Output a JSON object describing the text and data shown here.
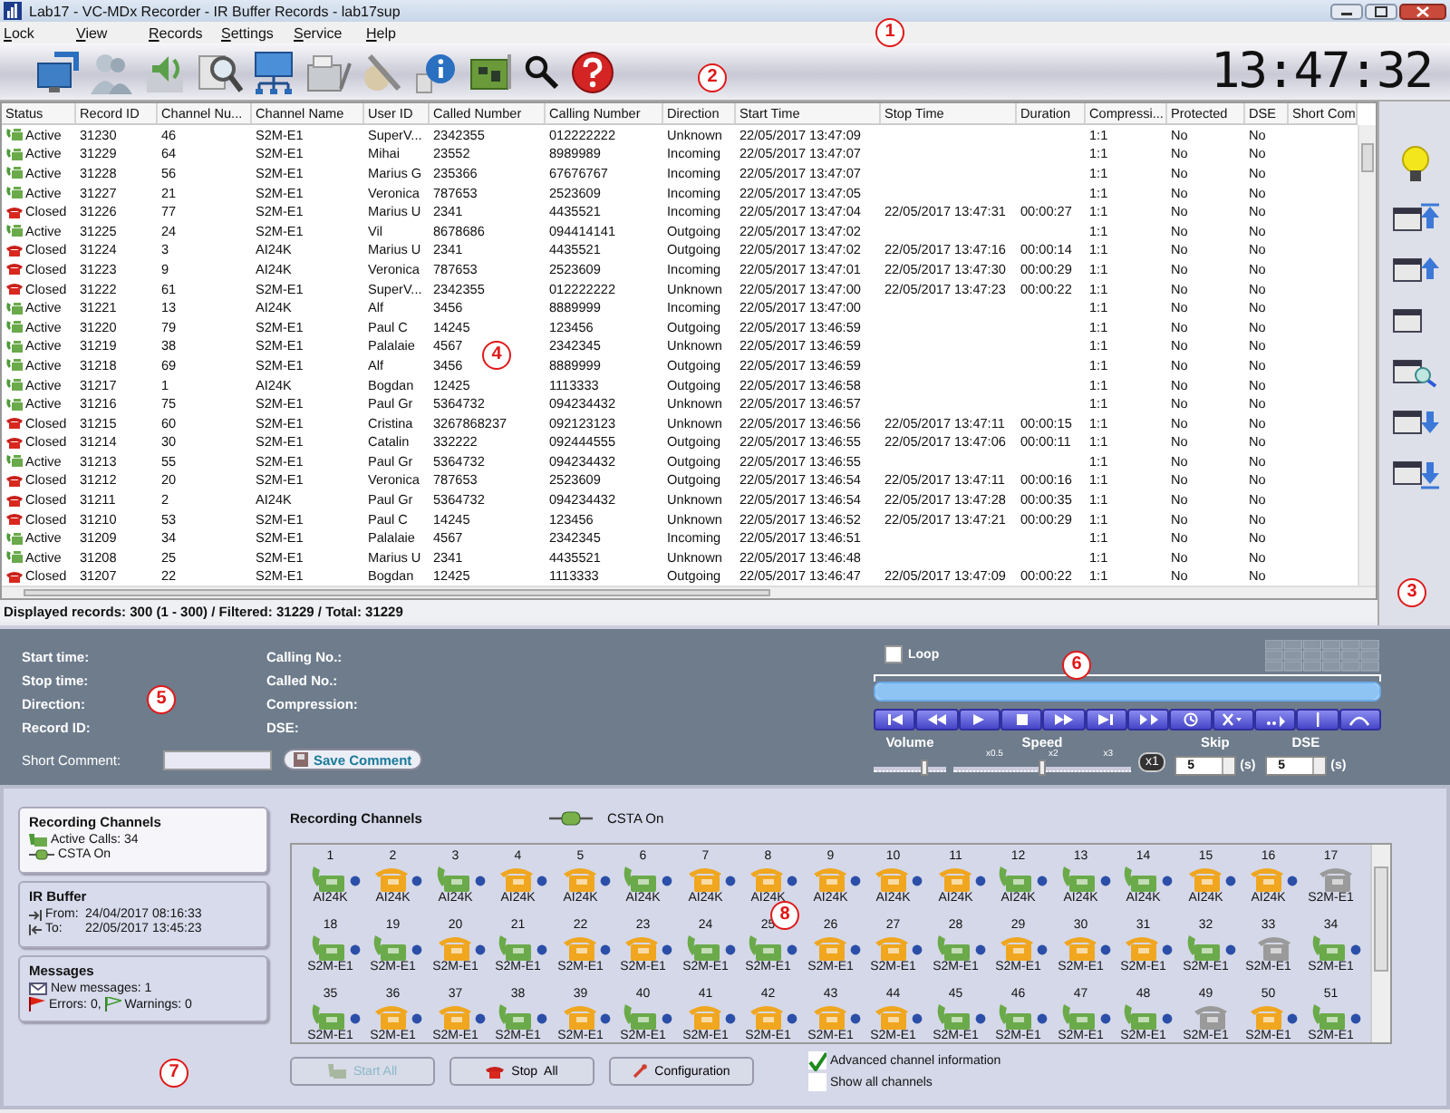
{
  "window": {
    "title": "Lab17 - VC-MDx Recorder - IR Buffer Records - lab17sup"
  },
  "menu": [
    "Lock",
    "View",
    "Records",
    "Settings",
    "Service",
    "Help"
  ],
  "clock": "13:47:32",
  "table": {
    "columns": [
      "Status",
      "Record ID",
      "Channel Nu...",
      "Channel Name",
      "User ID",
      "Called Number",
      "Calling Number",
      "Direction",
      "Start Time",
      "Stop Time",
      "Duration",
      "Compressi...",
      "Protected",
      "DSE",
      "Short Com"
    ],
    "rows": [
      {
        "kind": "active",
        "status": "Active",
        "record_id": "31230",
        "channel_number": "46",
        "channel_name": "S2M-E1",
        "user_id": "SuperV...",
        "called_number": "2342355",
        "calling_number": "012222222",
        "direction": "Unknown",
        "start_time": "22/05/2017 13:47:09",
        "compression": "1:1",
        "protected": "No",
        "dse": "No"
      },
      {
        "kind": "active",
        "status": "Active",
        "record_id": "31229",
        "channel_number": "64",
        "channel_name": "S2M-E1",
        "user_id": "Mihai",
        "called_number": "23552",
        "calling_number": "8989989",
        "direction": "Incoming",
        "start_time": "22/05/2017 13:47:07",
        "compression": "1:1",
        "protected": "No",
        "dse": "No"
      },
      {
        "kind": "active",
        "status": "Active",
        "record_id": "31228",
        "channel_number": "56",
        "channel_name": "S2M-E1",
        "user_id": "Marius G",
        "called_number": "235366",
        "calling_number": "67676767",
        "direction": "Incoming",
        "start_time": "22/05/2017 13:47:07",
        "compression": "1:1",
        "protected": "No",
        "dse": "No"
      },
      {
        "kind": "active",
        "status": "Active",
        "record_id": "31227",
        "channel_number": "21",
        "channel_name": "S2M-E1",
        "user_id": "Veronica",
        "called_number": "787653",
        "calling_number": "2523609",
        "direction": "Incoming",
        "start_time": "22/05/2017 13:47:05",
        "compression": "1:1",
        "protected": "No",
        "dse": "No"
      },
      {
        "kind": "closed",
        "status": "Closed",
        "record_id": "31226",
        "channel_number": "77",
        "channel_name": "S2M-E1",
        "user_id": "Marius U",
        "called_number": "2341",
        "calling_number": "4435521",
        "direction": "Incoming",
        "start_time": "22/05/2017 13:47:04",
        "stop_time": "22/05/2017 13:47:31",
        "duration": "00:00:27",
        "compression": "1:1",
        "protected": "No",
        "dse": "No"
      },
      {
        "kind": "active",
        "status": "Active",
        "record_id": "31225",
        "channel_number": "24",
        "channel_name": "S2M-E1",
        "user_id": "Vil",
        "called_number": "8678686",
        "calling_number": "094414141",
        "direction": "Outgoing",
        "start_time": "22/05/2017 13:47:02",
        "compression": "1:1",
        "protected": "No",
        "dse": "No"
      },
      {
        "kind": "closed",
        "status": "Closed",
        "record_id": "31224",
        "channel_number": "3",
        "channel_name": "AI24K",
        "user_id": "Marius U",
        "called_number": "2341",
        "calling_number": "4435521",
        "direction": "Outgoing",
        "start_time": "22/05/2017 13:47:02",
        "stop_time": "22/05/2017 13:47:16",
        "duration": "00:00:14",
        "compression": "1:1",
        "protected": "No",
        "dse": "No"
      },
      {
        "kind": "closed",
        "status": "Closed",
        "record_id": "31223",
        "channel_number": "9",
        "channel_name": "AI24K",
        "user_id": "Veronica",
        "called_number": "787653",
        "calling_number": "2523609",
        "direction": "Incoming",
        "start_time": "22/05/2017 13:47:01",
        "stop_time": "22/05/2017 13:47:30",
        "duration": "00:00:29",
        "compression": "1:1",
        "protected": "No",
        "dse": "No"
      },
      {
        "kind": "closed",
        "status": "Closed",
        "record_id": "31222",
        "channel_number": "61",
        "channel_name": "S2M-E1",
        "user_id": "SuperV...",
        "called_number": "2342355",
        "calling_number": "012222222",
        "direction": "Unknown",
        "start_time": "22/05/2017 13:47:00",
        "stop_time": "22/05/2017 13:47:23",
        "duration": "00:00:22",
        "compression": "1:1",
        "protected": "No",
        "dse": "No"
      },
      {
        "kind": "active",
        "status": "Active",
        "record_id": "31221",
        "channel_number": "13",
        "channel_name": "AI24K",
        "user_id": "Alf",
        "called_number": "3456",
        "calling_number": "8889999",
        "direction": "Incoming",
        "start_time": "22/05/2017 13:47:00",
        "compression": "1:1",
        "protected": "No",
        "dse": "No"
      },
      {
        "kind": "active",
        "status": "Active",
        "record_id": "31220",
        "channel_number": "79",
        "channel_name": "S2M-E1",
        "user_id": "Paul C",
        "called_number": "14245",
        "calling_number": "123456",
        "direction": "Outgoing",
        "start_time": "22/05/2017 13:46:59",
        "compression": "1:1",
        "protected": "No",
        "dse": "No"
      },
      {
        "kind": "active",
        "status": "Active",
        "record_id": "31219",
        "channel_number": "38",
        "channel_name": "S2M-E1",
        "user_id": "Palalaie",
        "called_number": "4567",
        "calling_number": "2342345",
        "direction": "Unknown",
        "start_time": "22/05/2017 13:46:59",
        "compression": "1:1",
        "protected": "No",
        "dse": "No"
      },
      {
        "kind": "active",
        "status": "Active",
        "record_id": "31218",
        "channel_number": "69",
        "channel_name": "S2M-E1",
        "user_id": "Alf",
        "called_number": "3456",
        "calling_number": "8889999",
        "direction": "Outgoing",
        "start_time": "22/05/2017 13:46:59",
        "compression": "1:1",
        "protected": "No",
        "dse": "No"
      },
      {
        "kind": "active",
        "status": "Active",
        "record_id": "31217",
        "channel_number": "1",
        "channel_name": "AI24K",
        "user_id": "Bogdan",
        "called_number": "12425",
        "calling_number": "1113333",
        "direction": "Outgoing",
        "start_time": "22/05/2017 13:46:58",
        "compression": "1:1",
        "protected": "No",
        "dse": "No"
      },
      {
        "kind": "active",
        "status": "Active",
        "record_id": "31216",
        "channel_number": "75",
        "channel_name": "S2M-E1",
        "user_id": "Paul Gr",
        "called_number": "5364732",
        "calling_number": "094234432",
        "direction": "Unknown",
        "start_time": "22/05/2017 13:46:57",
        "compression": "1:1",
        "protected": "No",
        "dse": "No"
      },
      {
        "kind": "closed",
        "status": "Closed",
        "record_id": "31215",
        "channel_number": "60",
        "channel_name": "S2M-E1",
        "user_id": "Cristina",
        "called_number": "3267868237",
        "calling_number": "092123123",
        "direction": "Unknown",
        "start_time": "22/05/2017 13:46:56",
        "stop_time": "22/05/2017 13:47:11",
        "duration": "00:00:15",
        "compression": "1:1",
        "protected": "No",
        "dse": "No"
      },
      {
        "kind": "closed",
        "status": "Closed",
        "record_id": "31214",
        "channel_number": "30",
        "channel_name": "S2M-E1",
        "user_id": "Catalin",
        "called_number": "332222",
        "calling_number": "092444555",
        "direction": "Outgoing",
        "start_time": "22/05/2017 13:46:55",
        "stop_time": "22/05/2017 13:47:06",
        "duration": "00:00:11",
        "compression": "1:1",
        "protected": "No",
        "dse": "No"
      },
      {
        "kind": "active",
        "status": "Active",
        "record_id": "31213",
        "channel_number": "55",
        "channel_name": "S2M-E1",
        "user_id": "Paul Gr",
        "called_number": "5364732",
        "calling_number": "094234432",
        "direction": "Outgoing",
        "start_time": "22/05/2017 13:46:55",
        "compression": "1:1",
        "protected": "No",
        "dse": "No"
      },
      {
        "kind": "closed",
        "status": "Closed",
        "record_id": "31212",
        "channel_number": "20",
        "channel_name": "S2M-E1",
        "user_id": "Veronica",
        "called_number": "787653",
        "calling_number": "2523609",
        "direction": "Outgoing",
        "start_time": "22/05/2017 13:46:54",
        "stop_time": "22/05/2017 13:47:11",
        "duration": "00:00:16",
        "compression": "1:1",
        "protected": "No",
        "dse": "No"
      },
      {
        "kind": "closed",
        "status": "Closed",
        "record_id": "31211",
        "channel_number": "2",
        "channel_name": "AI24K",
        "user_id": "Paul Gr",
        "called_number": "5364732",
        "calling_number": "094234432",
        "direction": "Unknown",
        "start_time": "22/05/2017 13:46:54",
        "stop_time": "22/05/2017 13:47:28",
        "duration": "00:00:35",
        "compression": "1:1",
        "protected": "No",
        "dse": "No"
      },
      {
        "kind": "closed",
        "status": "Closed",
        "record_id": "31210",
        "channel_number": "53",
        "channel_name": "S2M-E1",
        "user_id": "Paul C",
        "called_number": "14245",
        "calling_number": "123456",
        "direction": "Unknown",
        "start_time": "22/05/2017 13:46:52",
        "stop_time": "22/05/2017 13:47:21",
        "duration": "00:00:29",
        "compression": "1:1",
        "protected": "No",
        "dse": "No"
      },
      {
        "kind": "active",
        "status": "Active",
        "record_id": "31209",
        "channel_number": "34",
        "channel_name": "S2M-E1",
        "user_id": "Palalaie",
        "called_number": "4567",
        "calling_number": "2342345",
        "direction": "Incoming",
        "start_time": "22/05/2017 13:46:51",
        "compression": "1:1",
        "protected": "No",
        "dse": "No"
      },
      {
        "kind": "active",
        "status": "Active",
        "record_id": "31208",
        "channel_number": "25",
        "channel_name": "S2M-E1",
        "user_id": "Marius U",
        "called_number": "2341",
        "calling_number": "4435521",
        "direction": "Unknown",
        "start_time": "22/05/2017 13:46:48",
        "compression": "1:1",
        "protected": "No",
        "dse": "No"
      },
      {
        "kind": "closed",
        "status": "Closed",
        "record_id": "31207",
        "channel_number": "22",
        "channel_name": "S2M-E1",
        "user_id": "Bogdan",
        "called_number": "12425",
        "calling_number": "1113333",
        "direction": "Outgoing",
        "start_time": "22/05/2017 13:46:47",
        "stop_time": "22/05/2017 13:47:09",
        "duration": "00:00:22",
        "compression": "1:1",
        "protected": "No",
        "dse": "No"
      }
    ]
  },
  "status_bar": "Displayed records: 300 (1 - 300) / Filtered: 31229 / Total: 31229",
  "details": {
    "left": [
      "Start time:",
      "Stop time:",
      "Direction:",
      "Record ID:"
    ],
    "right": [
      "Calling No.:",
      "Called No.:",
      "Compression:",
      "DSE:"
    ],
    "comment_label": "Short Comment:",
    "save_button": "Save Comment"
  },
  "player": {
    "progress": {
      "level": 1
    },
    "loop": {
      "label": "Loop",
      "checked": false
    },
    "volume": {
      "label": "Volume",
      "level": 0.7
    },
    "speed": {
      "label": "Speed",
      "level": 0.5,
      "marks": [
        "x0.5",
        "x2",
        "x3"
      ]
    },
    "speed_button": "x1",
    "skip": {
      "label": "Skip",
      "value": "5",
      "unit": "(s)"
    },
    "dse": {
      "label": "DSE",
      "value": "5",
      "unit": "(s)"
    }
  },
  "summary": [
    {
      "title": "Recording Channels",
      "lines": [
        {
          "kind": "calls",
          "text": "Active Calls: 34"
        },
        {
          "kind": "csta",
          "text": "CSTA On"
        }
      ],
      "selected": true
    },
    {
      "title": "IR Buffer",
      "lines": [
        {
          "kind": "from",
          "label": "From:",
          "text": "24/04/2017 08:16:33"
        },
        {
          "kind": "to",
          "label": "To:",
          "text": "22/05/2017 13:45:23"
        }
      ],
      "selected": false
    },
    {
      "title": "Messages",
      "lines": [
        {
          "kind": "messages",
          "text": "New messages: 1"
        },
        {
          "kind": "errors",
          "text": "Errors: 0,",
          "extra": "Warnings: 0"
        }
      ],
      "selected": false
    }
  ],
  "channels_panel": {
    "title": "Recording Channels",
    "csta": "CSTA On",
    "channels": [
      {
        "number": "1",
        "type": "AI24K",
        "color": "#6aaa4a",
        "lifted": true,
        "online": true
      },
      {
        "number": "2",
        "type": "AI24K",
        "color": "#f0a61e",
        "lifted": false,
        "online": true
      },
      {
        "number": "3",
        "type": "AI24K",
        "color": "#6aaa4a",
        "lifted": true,
        "online": true
      },
      {
        "number": "4",
        "type": "AI24K",
        "color": "#f0a61e",
        "lifted": false,
        "online": true
      },
      {
        "number": "5",
        "type": "AI24K",
        "color": "#f0a61e",
        "lifted": false,
        "online": true
      },
      {
        "number": "6",
        "type": "AI24K",
        "color": "#6aaa4a",
        "lifted": true,
        "online": true
      },
      {
        "number": "7",
        "type": "AI24K",
        "color": "#f0a61e",
        "lifted": false,
        "online": true
      },
      {
        "number": "8",
        "type": "AI24K",
        "color": "#f0a61e",
        "lifted": false,
        "online": true
      },
      {
        "number": "9",
        "type": "AI24K",
        "color": "#f0a61e",
        "lifted": false,
        "online": true
      },
      {
        "number": "10",
        "type": "AI24K",
        "color": "#f0a61e",
        "lifted": false,
        "online": true
      },
      {
        "number": "11",
        "type": "AI24K",
        "color": "#f0a61e",
        "lifted": false,
        "online": true
      },
      {
        "number": "12",
        "type": "AI24K",
        "color": "#6aaa4a",
        "lifted": true,
        "online": true
      },
      {
        "number": "13",
        "type": "AI24K",
        "color": "#6aaa4a",
        "lifted": true,
        "online": true
      },
      {
        "number": "14",
        "type": "AI24K",
        "color": "#6aaa4a",
        "lifted": true,
        "online": true
      },
      {
        "number": "15",
        "type": "AI24K",
        "color": "#f0a61e",
        "lifted": false,
        "online": true
      },
      {
        "number": "16",
        "type": "AI24K",
        "color": "#f0a61e",
        "lifted": false,
        "online": true
      },
      {
        "number": "17",
        "type": "S2M-E1",
        "color": "#9a9a9a",
        "lifted": false,
        "online": false
      },
      {
        "number": "18",
        "type": "S2M-E1",
        "color": "#6aaa4a",
        "lifted": true,
        "online": true
      },
      {
        "number": "19",
        "type": "S2M-E1",
        "color": "#6aaa4a",
        "lifted": true,
        "online": true
      },
      {
        "number": "20",
        "type": "S2M-E1",
        "color": "#f0a61e",
        "lifted": false,
        "online": true
      },
      {
        "number": "21",
        "type": "S2M-E1",
        "color": "#6aaa4a",
        "lifted": true,
        "online": true
      },
      {
        "number": "22",
        "type": "S2M-E1",
        "color": "#f0a61e",
        "lifted": false,
        "online": true
      },
      {
        "number": "23",
        "type": "S2M-E1",
        "color": "#f0a61e",
        "lifted": false,
        "online": true
      },
      {
        "number": "24",
        "type": "S2M-E1",
        "color": "#6aaa4a",
        "lifted": true,
        "online": true
      },
      {
        "number": "25",
        "type": "S2M-E1",
        "color": "#6aaa4a",
        "lifted": true,
        "online": true
      },
      {
        "number": "26",
        "type": "S2M-E1",
        "color": "#f0a61e",
        "lifted": false,
        "online": true
      },
      {
        "number": "27",
        "type": "S2M-E1",
        "color": "#f0a61e",
        "lifted": false,
        "online": true
      },
      {
        "number": "28",
        "type": "S2M-E1",
        "color": "#6aaa4a",
        "lifted": true,
        "online": true
      },
      {
        "number": "29",
        "type": "S2M-E1",
        "color": "#f0a61e",
        "lifted": false,
        "online": true
      },
      {
        "number": "30",
        "type": "S2M-E1",
        "color": "#f0a61e",
        "lifted": false,
        "online": true
      },
      {
        "number": "31",
        "type": "S2M-E1",
        "color": "#f0a61e",
        "lifted": false,
        "online": true
      },
      {
        "number": "32",
        "type": "S2M-E1",
        "color": "#6aaa4a",
        "lifted": true,
        "online": true
      },
      {
        "number": "33",
        "type": "S2M-E1",
        "color": "#9a9a9a",
        "lifted": false,
        "online": false
      },
      {
        "number": "34",
        "type": "S2M-E1",
        "color": "#6aaa4a",
        "lifted": true,
        "online": true
      },
      {
        "number": "35",
        "type": "S2M-E1",
        "color": "#6aaa4a",
        "lifted": true,
        "online": true
      },
      {
        "number": "36",
        "type": "S2M-E1",
        "color": "#f0a61e",
        "lifted": false,
        "online": true
      },
      {
        "number": "37",
        "type": "S2M-E1",
        "color": "#f0a61e",
        "lifted": false,
        "online": true
      },
      {
        "number": "38",
        "type": "S2M-E1",
        "color": "#6aaa4a",
        "lifted": true,
        "online": true
      },
      {
        "number": "39",
        "type": "S2M-E1",
        "color": "#f0a61e",
        "lifted": false,
        "online": true
      },
      {
        "number": "40",
        "type": "S2M-E1",
        "color": "#6aaa4a",
        "lifted": true,
        "online": true
      },
      {
        "number": "41",
        "type": "S2M-E1",
        "color": "#f0a61e",
        "lifted": false,
        "online": true
      },
      {
        "number": "42",
        "type": "S2M-E1",
        "color": "#f0a61e",
        "lifted": false,
        "online": true
      },
      {
        "number": "43",
        "type": "S2M-E1",
        "color": "#f0a61e",
        "lifted": false,
        "online": true
      },
      {
        "number": "44",
        "type": "S2M-E1",
        "color": "#f0a61e",
        "lifted": false,
        "online": true
      },
      {
        "number": "45",
        "type": "S2M-E1",
        "color": "#6aaa4a",
        "lifted": true,
        "online": true
      },
      {
        "number": "46",
        "type": "S2M-E1",
        "color": "#6aaa4a",
        "lifted": true,
        "online": true
      },
      {
        "number": "47",
        "type": "S2M-E1",
        "color": "#6aaa4a",
        "lifted": true,
        "online": true
      },
      {
        "number": "48",
        "type": "S2M-E1",
        "color": "#6aaa4a",
        "lifted": true,
        "online": true
      },
      {
        "number": "49",
        "type": "S2M-E1",
        "color": "#9a9a9a",
        "lifted": false,
        "online": false
      },
      {
        "number": "50",
        "type": "S2M-E1",
        "color": "#f0a61e",
        "lifted": false,
        "online": true
      },
      {
        "number": "51",
        "type": "S2M-E1",
        "color": "#6aaa4a",
        "lifted": true,
        "online": true
      }
    ],
    "buttons": [
      {
        "kind": "start",
        "label": "Start All",
        "disabled": true
      },
      {
        "kind": "stop",
        "label": "Stop  All",
        "disabled": false
      },
      {
        "kind": "config",
        "label": "Configuration",
        "disabled": false
      }
    ],
    "options": [
      {
        "label": "Advanced channel information",
        "checked": true
      },
      {
        "label": "Show all channels",
        "checked": false
      }
    ]
  },
  "callouts": [
    "1",
    "2",
    "3",
    "4",
    "5",
    "6",
    "7",
    "8"
  ]
}
